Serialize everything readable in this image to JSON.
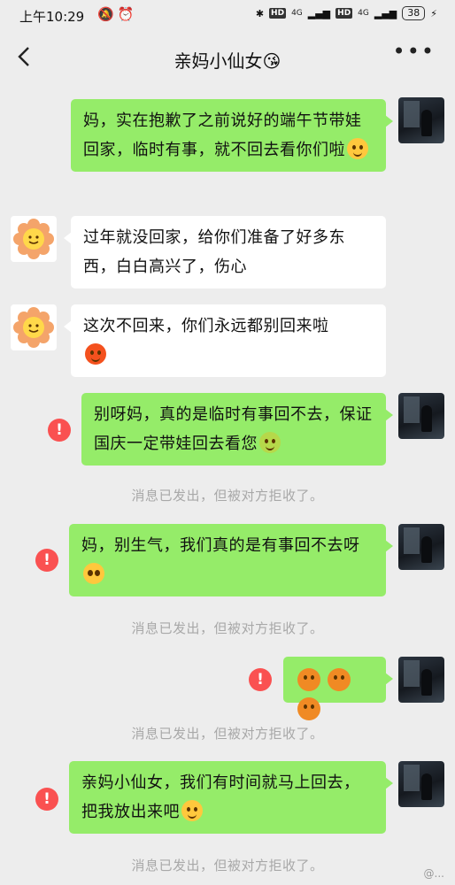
{
  "status_bar": {
    "time": "上午10:29",
    "network": "4G",
    "hd": "HD",
    "battery": "38"
  },
  "nav": {
    "title": "亲妈小仙女😘"
  },
  "messages": [
    {
      "side": "me",
      "text": "妈，实在抱歉了之前说好的端午节带娃回家，临时有事，就不回去看你们啦",
      "emoji": "loudly-crying-face"
    },
    {
      "side": "mom",
      "text": "过年就没回家，给你们准备了好多东西，白白高兴了，伤心"
    },
    {
      "side": "mom",
      "text": "这次不回来，你们永远都别回来啦",
      "emoji": "angry-face"
    },
    {
      "side": "me",
      "text": "别呀妈，真的是临时有事回不去，保证国庆一定带娃回去看您",
      "emoji": "hug-face",
      "failed": true
    },
    {
      "side": "me",
      "text": "妈，别生气，我们真的是有事回不去呀",
      "emoji": "pleading-face",
      "failed": true
    },
    {
      "side": "me",
      "text": "",
      "emoji": "pouting-face-x3",
      "failed": true
    },
    {
      "side": "me",
      "text": "亲妈小仙女，我们有时间就马上回去，把我放出来吧",
      "emoji": "rolling-laughing-face",
      "failed": true
    }
  ],
  "system_notice": "消息已发出，但被对方拒收了。",
  "watermark": "@..."
}
